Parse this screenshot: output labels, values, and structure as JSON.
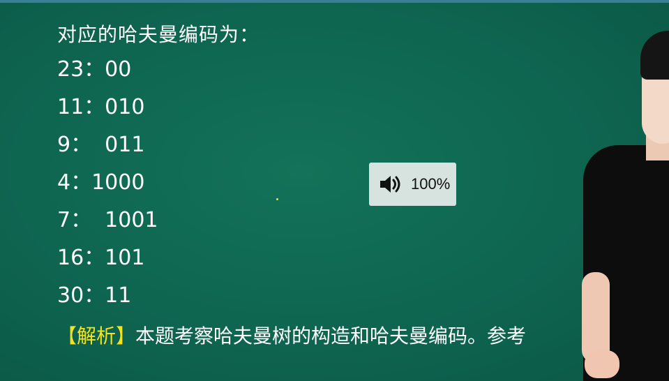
{
  "heading": "对应的哈夫曼编码为：",
  "codes": [
    "23：00",
    "11：010",
    "9：  011",
    "4：1000",
    "7：  1001",
    "16：101",
    "30：11"
  ],
  "analysis": {
    "tag": "【解析】",
    "text": "本题考察哈夫曼树的构造和哈夫曼编码。参考"
  },
  "volume": {
    "icon": "speaker-icon",
    "level": "100%"
  },
  "colors": {
    "board": "#0f604f",
    "text": "#ffffff",
    "highlight": "#f4e21b",
    "osd_background": "#d6e3df"
  }
}
